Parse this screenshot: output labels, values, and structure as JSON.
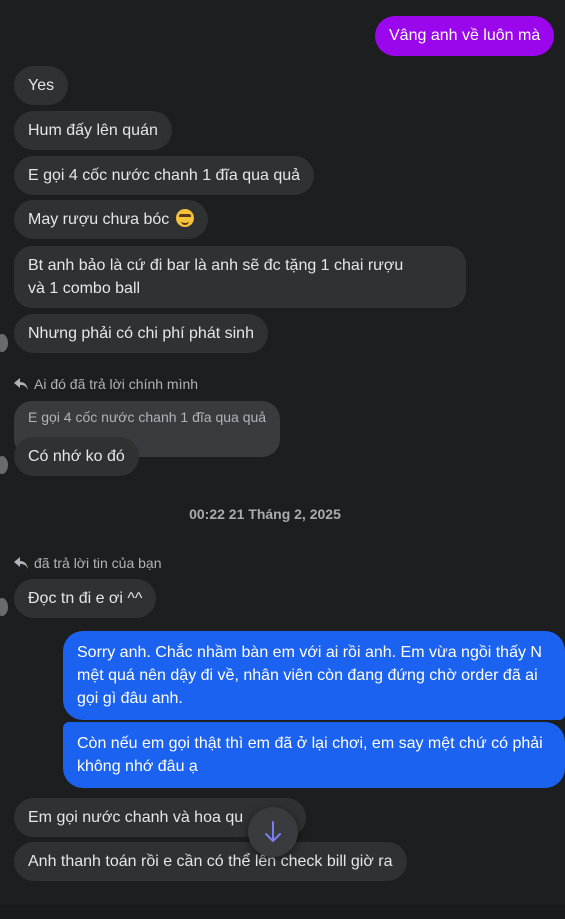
{
  "messages": {
    "m1": "Vâng anh về luôn mà",
    "m2": "Yes",
    "m3": "Hum đấy lên quán",
    "m4": "E gọi 4 cốc nước chanh 1 đĩa qua quả",
    "m5": "May rượu chưa bóc",
    "m5_emoji": "sweat-smile-emoji",
    "m6": "Bt anh bảo là cứ đi bar là anh sẽ đc tặng 1 chai rượu\nvà 1 combo ball",
    "m7": "Nhưng phải có chi phí phát sinh",
    "m8": "Có nhớ ko đó",
    "m9": "Đọc tn đi e ơi ^^",
    "m10": "Sorry anh. Chắc nhầm bàn em với ai rồi anh. Em vừa ngồi thấy N  mệt quá nên dậy đi về, nhân viên còn đang đứng chờ order đã ai gọi gì đâu anh.",
    "m11": "Còn nếu em gọi thật thì em đã ở lại chơi, em say mệt chứ có phải không nhớ đâu ạ",
    "m12": "Em gọi nước chanh và hoa qu",
    "m13": "Anh thanh toán rồi e cần có thể lên check bill giờ ra"
  },
  "reply1": {
    "label": "Ai đó đã trả lời chính mình",
    "quote": "E gọi 4 cốc nước chanh 1 đĩa qua quả"
  },
  "reply2": {
    "label": "đã trả lời tin của bạn"
  },
  "timestamp": "00:22 21 Tháng 2, 2025",
  "colors": {
    "background": "#1d1e20",
    "incoming": "#303133",
    "outgoing_purple": "#9a07ec",
    "outgoing_blue": "#1c62f0"
  },
  "icons": {
    "reply": "reply-arrow-icon",
    "scroll": "arrow-down-icon"
  }
}
